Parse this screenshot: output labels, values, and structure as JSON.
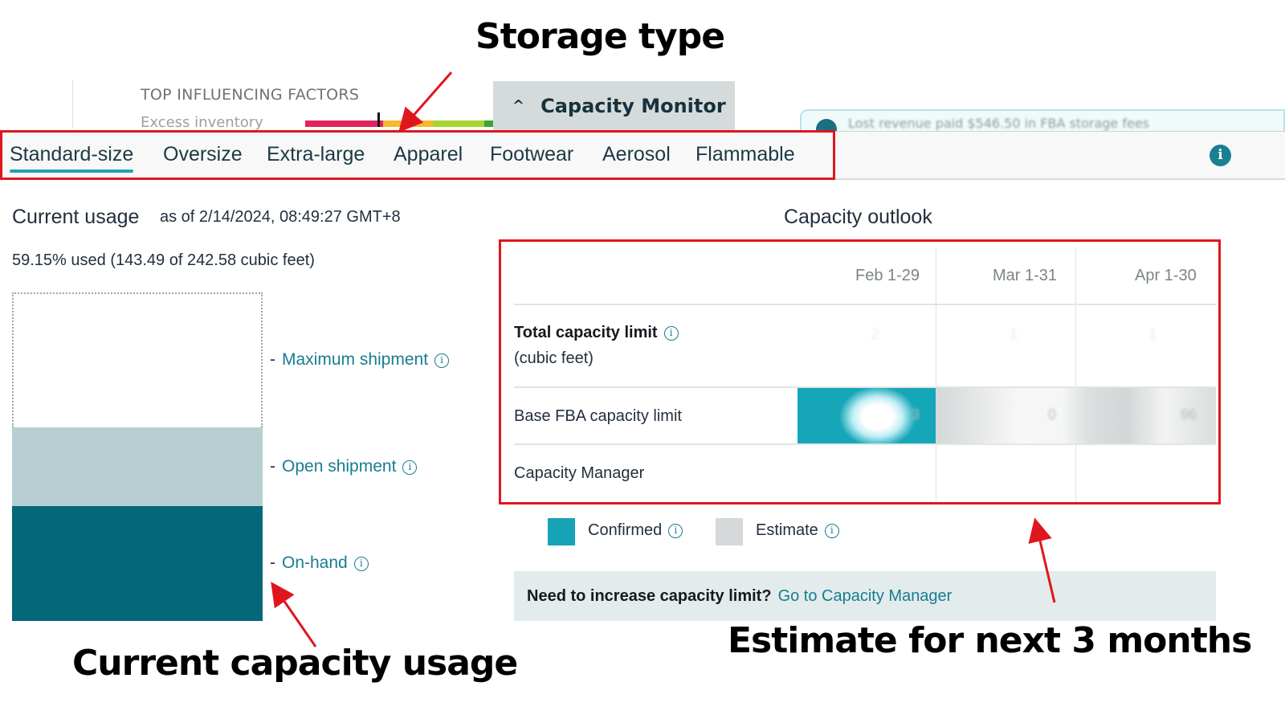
{
  "annotations": {
    "storage_type": "Storage type",
    "current_capacity_usage": "Current capacity usage",
    "estimate_next_3_months": "Estimate for next 3 months",
    "highlight_color": "#e0161e"
  },
  "background_page": {
    "top_influencing_factors": "TOP INFLUENCING FACTORS",
    "excess_inventory_label": "Excess inventory",
    "factor_bar_colors": [
      "#e0245e",
      "#f5b82e",
      "#a6d62e",
      "#3aa53a"
    ],
    "alert_text_blurred": "Lost revenue paid $546.50 in FBA storage fees"
  },
  "capacity_monitor": {
    "header_label": "Capacity Monitor",
    "chevron_icon": "chevron-up-icon"
  },
  "storage_tabs": {
    "active": "Standard-size",
    "items": [
      {
        "label": "Standard-size"
      },
      {
        "label": "Oversize"
      },
      {
        "label": "Extra-large"
      },
      {
        "label": "Apparel"
      },
      {
        "label": "Footwear"
      },
      {
        "label": "Aerosol"
      },
      {
        "label": "Flammable"
      }
    ],
    "info_icon": "i",
    "accent_color": "#20a2b5"
  },
  "current_usage": {
    "title": "Current usage",
    "as_of": "as of 2/14/2024, 08:49:27 GMT+8",
    "summary": "59.15% used (143.49 of 242.58 cubic feet)",
    "percent_used": 59.15,
    "used_cubic_feet": 143.49,
    "limit_cubic_feet": 242.58,
    "segments": [
      {
        "name": "Maximum shipment",
        "share_of_bar": 0.41,
        "color": "#ffffff"
      },
      {
        "name": "Open shipment",
        "share_of_bar": 0.24,
        "color": "#b7cfd3"
      },
      {
        "name": "On-hand",
        "share_of_bar": 0.35,
        "color": "#05677a"
      }
    ],
    "legend": {
      "dash": "-",
      "maximum_shipment": "Maximum shipment",
      "open_shipment": "Open shipment",
      "on_hand": "On-hand",
      "info_glyph": "i"
    }
  },
  "capacity_outlook": {
    "title": "Capacity outlook",
    "columns": [
      "Feb 1-29",
      "Mar 1-31",
      "Apr 1-30"
    ],
    "rows": {
      "total_label": "Total capacity limit",
      "total_unit": "(cubic feet)",
      "total_values_blurred": [
        "2",
        "1",
        "1"
      ],
      "base_label": "Base FBA capacity limit",
      "base_values_blurred": [
        "3",
        "0",
        "96"
      ],
      "capacity_manager_label": "Capacity Manager"
    },
    "legend": {
      "confirmed": "Confirmed",
      "estimate": "Estimate",
      "confirmed_color": "#16a3b6",
      "estimate_color": "#d5d9da"
    },
    "cta": {
      "question": "Need to increase capacity limit?",
      "link": "Go to Capacity Manager"
    }
  }
}
